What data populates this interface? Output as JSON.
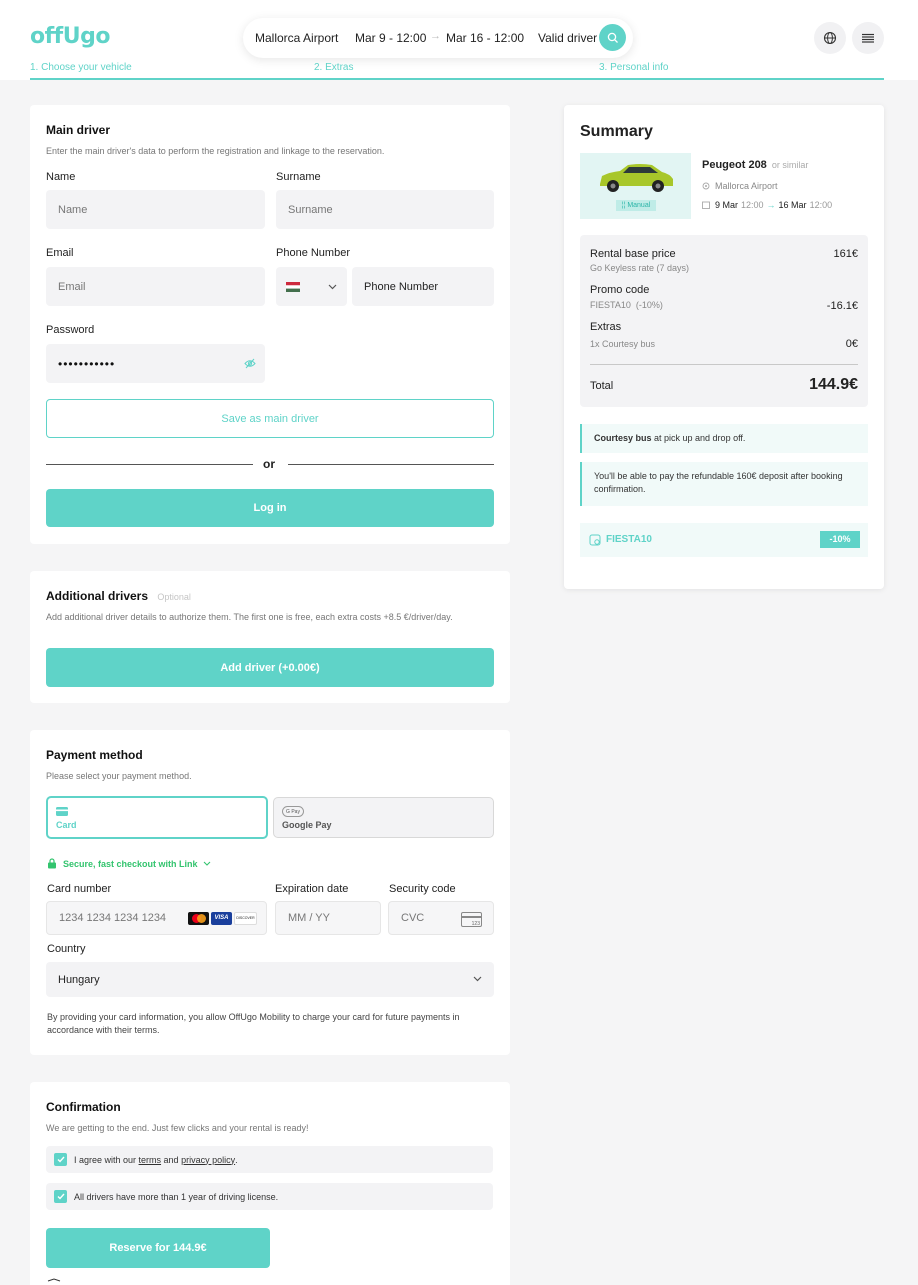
{
  "brand": {
    "name": "offUgo",
    "accent": "#5fd3c8"
  },
  "search": {
    "location": "Mallorca Airport",
    "pickup": "Mar 9 - 12:00",
    "dropoff": "Mar 16 - 12:00",
    "driver": "Valid driver"
  },
  "steps": [
    "1. Choose your vehicle",
    "2. Extras",
    "3. Personal info"
  ],
  "main_driver": {
    "title": "Main driver",
    "description": "Enter the main driver's data to perform the registration and linkage to the reservation.",
    "name_label": "Name",
    "name_placeholder": "Name",
    "surname_label": "Surname",
    "surname_placeholder": "Surname",
    "email_label": "Email",
    "email_placeholder": "Email",
    "phone_label": "Phone Number",
    "phone_placeholder": "Phone Number",
    "password_label": "Password",
    "password_value": "•••••••••••",
    "save_button": "Save as main driver",
    "or": "or",
    "login_button": "Log in"
  },
  "additional_drivers": {
    "title": "Additional drivers",
    "optional": "Optional",
    "description": "Add additional driver details to authorize them. The first one is free, each extra costs +8.5 €/driver/day.",
    "add_button": "Add driver (+0.00€)"
  },
  "payment": {
    "title": "Payment method",
    "description": "Please select your payment method.",
    "card_tab": "Card",
    "gpay_tab": "Google Pay",
    "gpay_badge": "G Pay",
    "link_text": "Secure, fast checkout with Link",
    "card_number_label": "Card number",
    "card_number_placeholder": "1234 1234 1234 1234",
    "expiry_label": "Expiration date",
    "expiry_placeholder": "MM / YY",
    "cvc_label": "Security code",
    "cvc_placeholder": "CVC",
    "cvc_icon_text": "123",
    "country_label": "Country",
    "country_value": "Hungary",
    "legal": "By providing your card information, you allow OffUgo Mobility to charge your card for future payments in accordance with their terms.",
    "brands": {
      "visa": "VISA",
      "discover": "DISCOVER"
    }
  },
  "confirmation": {
    "title": "Confirmation",
    "description": "We are getting to the end. Just few clicks and your rental is ready!",
    "terms_pre": "I agree with our ",
    "terms_link": "terms",
    "terms_mid": " and ",
    "privacy_link": "privacy policy",
    "terms_post": ".",
    "license": "All drivers have more than 1 year of driving license.",
    "reserve_button": "Reserve for 144.9€"
  },
  "summary": {
    "title": "Summary",
    "car": "Peugeot 208",
    "car_similar": "or similar",
    "transmission": "Manual",
    "location": "Mallorca Airport",
    "date_from": "9 Mar",
    "time_from": "12:00",
    "date_to": "16 Mar",
    "time_to": "12:00",
    "base_label": "Rental base price",
    "base_sub": "Go Keyless rate (7 days)",
    "base_value": "161€",
    "promo_label": "Promo code",
    "promo_sub": "FIESTA10  (-10%)",
    "promo_value": "-16.1€",
    "extras_label": "Extras",
    "extras_sub": "1x Courtesy bus",
    "extras_value": "0€",
    "total_label": "Total",
    "total_value": "144.9€",
    "notice_bus_bold": "Courtesy bus",
    "notice_bus_rest": " at pick up and drop off.",
    "notice_deposit": "You'll be able to pay the refundable 160€ deposit after booking confirmation.",
    "code": "FIESTA10",
    "code_discount": "-10%"
  }
}
